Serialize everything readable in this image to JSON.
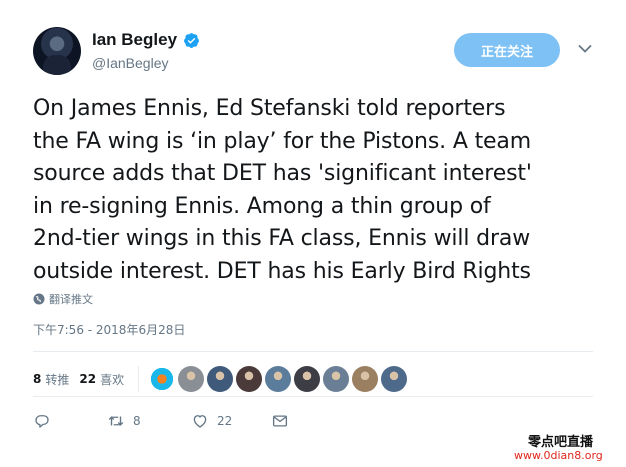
{
  "profile": {
    "display_name": "Ian Begley",
    "handle": "@IanBegley",
    "verified": true,
    "follow_button_label": "正在关注"
  },
  "tweet": {
    "lines": [
      "On James Ennis, Ed Stefanski told reporters",
      "the FA wing is ‘in play’ for the Pistons. A team",
      "source adds that DET has 'significant interest'",
      "in re-signing Ennis. Among a thin group of",
      "2nd-tier wings in this FA class, Ennis will draw",
      "outside interest. DET has his Early Bird Rights"
    ],
    "translate_label": "翻译推文",
    "timestamp": "下午7:56 - 2018年6月28日"
  },
  "stats": {
    "retweets_count": "8",
    "retweets_label": "转推",
    "likes_count": "22",
    "likes_label": "喜欢",
    "liker_avatar_colors": [
      "#2a8ec4",
      "#8a8f96",
      "#3f5a7a",
      "#4a3a3a",
      "#5b7c9a",
      "#3d3d45",
      "#6a7f95",
      "#9a8060",
      "#4e6a8a"
    ]
  },
  "actions": {
    "reply_icon": "reply-icon",
    "retweet_count": "8",
    "like_count": "22",
    "dm_icon": "message-icon"
  },
  "watermark": {
    "title": "零点吧直播",
    "url": "www.0dian8.org"
  },
  "colors": {
    "accent": "#1da1f2",
    "follow_button": "#7ec1f5",
    "secondary_text": "#657786",
    "watermark_red": "#e0271c"
  }
}
